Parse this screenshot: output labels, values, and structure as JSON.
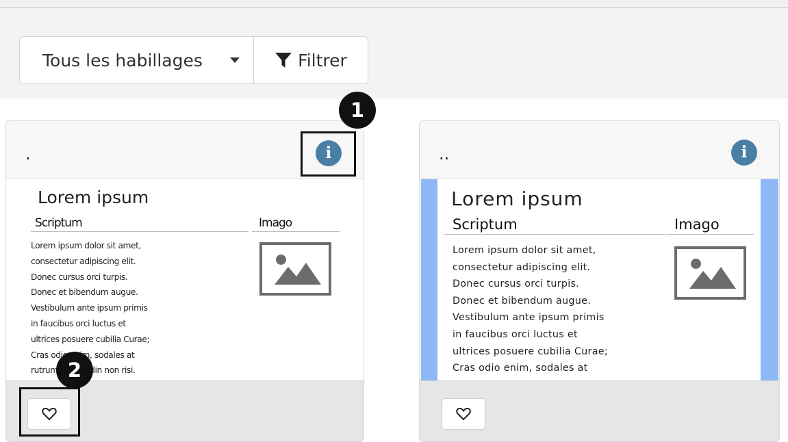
{
  "toolbar": {
    "select_value": "Tous les habillages",
    "filter_label": "Filtrer"
  },
  "cards": [
    {
      "title": ".",
      "preview": {
        "heading": "Lorem ipsum",
        "col_text": "Scriptum",
        "col_image": "Imago",
        "body": "Lorem ipsum dolor sit amet,\nconsectetur adipiscing elit.\nDonec cursus orci turpis.\nDonec et bibendum augue.\nVestibulum ante ipsum primis\nin faucibus orci luctus et\nultrices posuere cubilia Curae;\nCras odio enim, sodales at\nrutrum sollicitudin non risi."
      }
    },
    {
      "title": "..",
      "preview": {
        "heading": "Lorem ipsum",
        "col_text": "Scriptum",
        "col_image": "Imago",
        "body": "Lorem ipsum dolor sit amet,\nconsectetur adipiscing elit.\nDonec cursus orci turpis.\nDonec et bibendum augue.\nVestibulum ante ipsum primis\nin faucibus orci luctus et\nultrices posuere cubilia Curae;\nCras odio enim, sodales at"
      }
    }
  ],
  "annotations": [
    "1",
    "2"
  ],
  "colors": {
    "info": "#4a7fa5",
    "stripe": "#8db8f5",
    "footer": "#e6e6e6"
  },
  "icons": [
    "caret-down-icon",
    "filter-icon",
    "info-icon",
    "image-placeholder-icon",
    "heart-icon"
  ]
}
